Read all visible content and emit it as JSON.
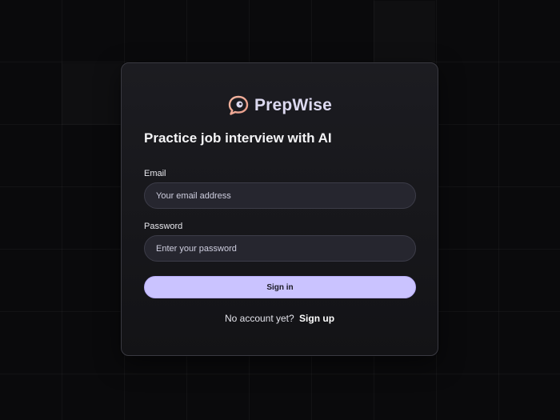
{
  "brand": {
    "name": "PrepWise",
    "icon": "chat-bubble-icon",
    "colors": {
      "icon_peach": "#f3b5a0",
      "icon_lilac": "#dcd9f0"
    }
  },
  "form": {
    "tagline": "Practice job interview with AI",
    "email": {
      "label": "Email",
      "placeholder": "Your email address",
      "value": ""
    },
    "password": {
      "label": "Password",
      "placeholder": "Enter your password",
      "value": ""
    },
    "submit_label": "Sign in",
    "footer_text": "No account yet?",
    "footer_link": "Sign up"
  },
  "colors": {
    "background": "#0a0a0c",
    "card": "#1a1a1f",
    "accent": "#cac3ff"
  }
}
